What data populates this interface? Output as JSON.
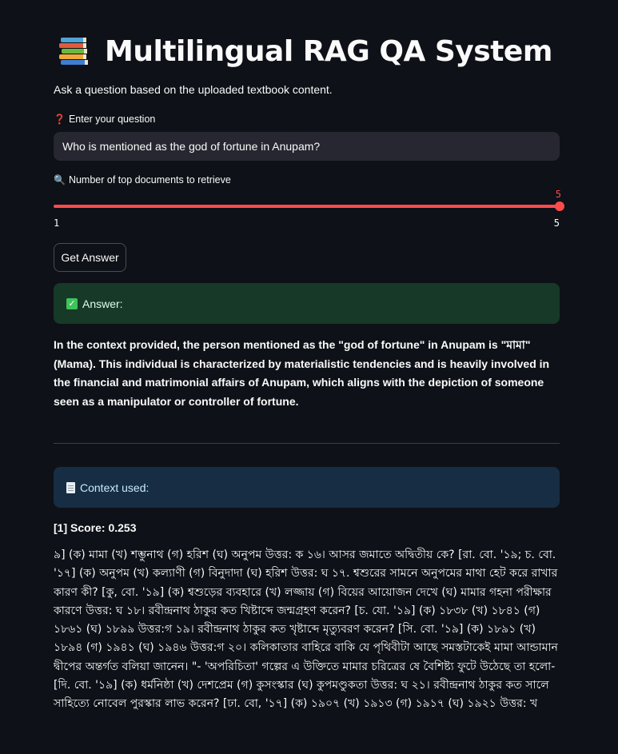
{
  "header": {
    "icon": "books-icon",
    "title": "Multilingual RAG QA System",
    "subtitle": "Ask a question based on the uploaded textbook content."
  },
  "question": {
    "label_glyph": "❓",
    "label": "Enter your question",
    "value": "Who is mentioned as the god of fortune in Anupam?"
  },
  "top_k": {
    "label_glyph": "🔍",
    "label": "Number of top documents to retrieve",
    "value": "5",
    "min": "1",
    "max": "5",
    "accent_color": "#ff4b4b"
  },
  "actions": {
    "get_answer_label": "Get Answer"
  },
  "answer": {
    "banner_label": "Answer:",
    "banner_color": "#173928",
    "text": "In the context provided, the person mentioned as the \"god of fortune\" in Anupam is \"মামা\" (Mama). This individual is characterized by materialistic tendencies and is heavily involved in the financial and matrimonial affairs of Anupam, which aligns with the depiction of someone seen as a manipulator or controller of fortune."
  },
  "context": {
    "banner_label": "Context used:",
    "banner_color": "#172d43",
    "items": [
      {
        "score_label": "[1] Score: 0.253",
        "text": "৯] (ক) মামা (খ) শম্ভুনাথ (গ) হরিশ (ঘ) অনুপম উত্তর: ক ১৬। আসর জমাতে অদ্বিতীয় কে? [রা. বো. '১৯; চ. বো. '১৭] (ক) অনুপম (খ) কল্যাণী (গ) বিনুদাদা (ঘ) হরিশ উত্তর: ঘ ১৭. শ্বশুরের সামনে অনুপমের মাথা হেট করে রাখার কারণ কী? [কু, বো. '১৯] (ক) শ্বশুড়ের ব্যবহারে (খ) লজ্জায় (গ) বিয়ের আয়োজন দেখে (ঘ) মামার গহনা পরীক্ষার কারণে উত্তর: ঘ ১৮। রবীন্দ্রনাথ ঠাকুর কত খিষ্টাব্দে জন্মগ্রহণ করেন? [চ. যো. '১৯] (ক) ১৮৩৮ (খ) ১৮৪১ (গ) ১৮৬১ (ঘ) ১৮৯৯ উত্তর:গ ১৯। রবীন্দ্রনাথ ঠাকুর কত খৃষ্টাব্দে মৃত্যুবরণ করেন? [সি. বো. '১৯] (ক) ১৮৯১ (খ) ১৮৯৪ (গ) ১৯৪১ (ঘ) ১৯৪৬ উত্তর:গ ২০। কলিকাতার বাহিরে বাকি যে পৃথিবীটা আছে সমস্তটাকেই মামা আন্ডামান দ্বীপের অন্তর্গত বলিয়া জানেন। \"- 'অপরিচিতা' গল্পের এ উক্তিতে মামার চরিত্রের ষে বৈশিষ্ট্য ফুটে উঠেছে তা হলো- [দি. বো. '১৯] (ক) ধর্মনিষ্ঠা (খ) দেশপ্রেম (গ) কুসংস্কার (ঘ) কুপমণ্ডুকতা উত্তর: ঘ ২১। রবীন্দ্রনাথ ঠাকুর কত সালে সাহিত্যে নোবেল পুরস্কার লাভ করেন? [ঢা. বো, '১৭] (ক) ১৯০৭ (খ) ১৯১৩ (গ) ১৯১৭ (ঘ) ১৯২১ উত্তর: খ"
      }
    ]
  }
}
